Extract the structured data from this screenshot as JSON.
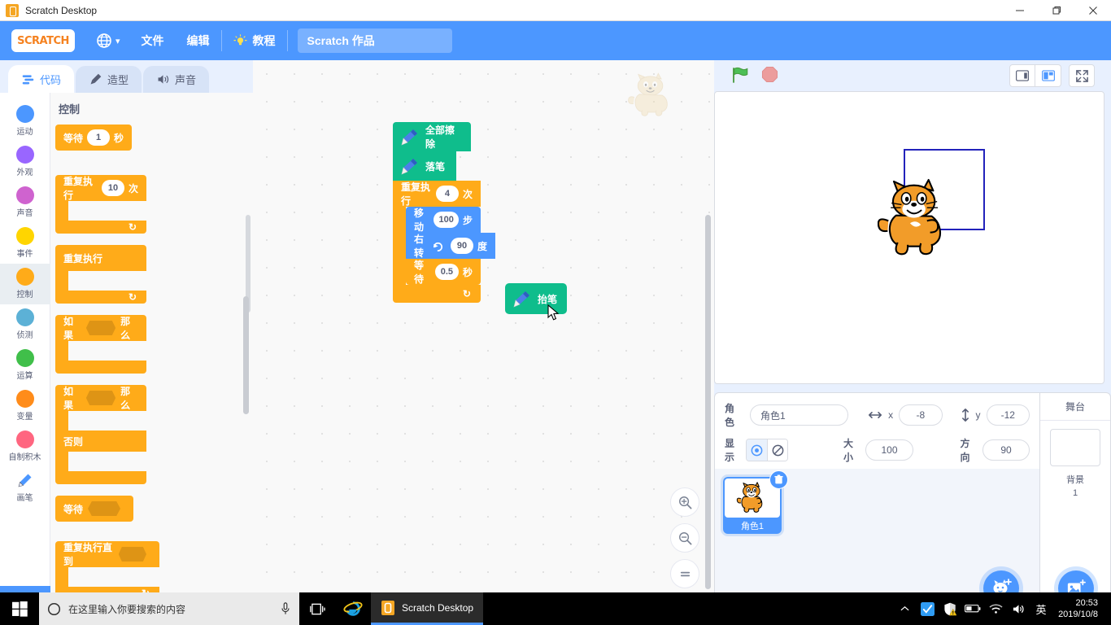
{
  "window": {
    "title": "Scratch Desktop",
    "app_icon": "scratch-app-icon",
    "minimize": "—",
    "maximize": "❐",
    "close": "✕"
  },
  "menubar": {
    "logo": "SCRATCH",
    "globe_icon": "globe-icon",
    "chevron": "▾",
    "items": [
      {
        "label": "文件"
      },
      {
        "label": "编辑"
      }
    ],
    "tutorials": {
      "icon": "lightbulb-icon",
      "label": "教程"
    },
    "project_name": "Scratch 作品"
  },
  "tabs": [
    {
      "label": "代码",
      "icon": "code-icon",
      "active": true
    },
    {
      "label": "造型",
      "icon": "brush-icon",
      "active": false
    },
    {
      "label": "声音",
      "icon": "speaker-icon",
      "active": false
    }
  ],
  "categories": [
    {
      "label": "运动",
      "color": "#4c97ff"
    },
    {
      "label": "外观",
      "color": "#9966ff"
    },
    {
      "label": "声音",
      "color": "#cf63cf"
    },
    {
      "label": "事件",
      "color": "#ffd500"
    },
    {
      "label": "控制",
      "color": "#ffab19",
      "selected": true
    },
    {
      "label": "侦测",
      "color": "#5cb1d6"
    },
    {
      "label": "运算",
      "color": "#40bf4a"
    },
    {
      "label": "变量",
      "color": "#ff8c1a"
    },
    {
      "label": "自制积木",
      "color": "#ff6680"
    },
    {
      "label": "画笔",
      "color": "#0fbd8c",
      "icon": "pen-icon"
    }
  ],
  "add_extension": {
    "label": "add-extension-icon"
  },
  "palette": {
    "title": "控制",
    "blocks": [
      {
        "name": "wait-seconds",
        "prefix": "等待",
        "value": "1",
        "suffix": "秒",
        "type": "stack"
      },
      {
        "name": "repeat-times",
        "prefix": "重复执行",
        "value": "10",
        "suffix": "次",
        "type": "c",
        "loop_arrow": "↻"
      },
      {
        "name": "forever",
        "prefix": "重复执行",
        "type": "c",
        "loop_arrow": "↻"
      },
      {
        "name": "if-then",
        "prefix": "如果",
        "suffix": "那么",
        "type": "c-hex"
      },
      {
        "name": "if-then-else",
        "prefix": "如果",
        "suffix": "那么",
        "else_label": "否则",
        "type": "c-else-hex"
      },
      {
        "name": "wait-until",
        "prefix": "等待",
        "type": "stack-hex"
      },
      {
        "name": "repeat-until",
        "prefix": "重复执行直到",
        "type": "c-hex",
        "loop_arrow": "↻"
      }
    ]
  },
  "script": {
    "blocks": [
      {
        "name": "pen-erase-all",
        "icon": "pen-icon",
        "label": "全部擦除",
        "color": "#0fbd8c"
      },
      {
        "name": "pen-down",
        "icon": "pen-icon",
        "label": "落笔",
        "color": "#0fbd8c"
      },
      {
        "name": "repeat-times",
        "prefix": "重复执行",
        "value": "4",
        "suffix": "次",
        "color": "#ffab19",
        "loop_arrow": "↻"
      },
      {
        "name": "move-steps",
        "prefix": "移动",
        "value": "100",
        "suffix": "步",
        "color": "#4c97ff"
      },
      {
        "name": "turn-right-degrees",
        "prefix": "右转",
        "icon": "turn-right-icon",
        "value": "90",
        "suffix": "度",
        "color": "#4c97ff"
      },
      {
        "name": "wait-seconds",
        "prefix": "等待",
        "value": "0.5",
        "suffix": "秒",
        "color": "#ffab19"
      }
    ],
    "loose_block": {
      "name": "pen-up",
      "icon": "pen-icon",
      "label": "抬笔",
      "color": "#0fbd8c"
    }
  },
  "canvas": {
    "watermark": "scratch-cat-watermark",
    "zoom_in": "zoom-in-icon",
    "zoom_out": "zoom-out-icon",
    "zoom_reset": "zoom-reset-icon"
  },
  "stage_header": {
    "green_flag": "green-flag-icon",
    "stop": "stop-icon",
    "small_stage": "small-stage-icon",
    "large_stage": "large-stage-icon",
    "fullscreen": "fullscreen-icon"
  },
  "stage": {
    "drawing": {
      "shape": "square",
      "color": "#2222bb"
    },
    "sprite": "scratch-cat"
  },
  "sprite_info": {
    "sprite_label": "角色",
    "sprite_name": "角色1",
    "x_label": "x",
    "x_value": "-8",
    "y_label": "y",
    "y_value": "-12",
    "show_label": "显示",
    "show_icon": "eye-visible-icon",
    "hide_icon": "eye-hidden-icon",
    "size_label": "大小",
    "size_value": "100",
    "direction_label": "方向",
    "direction_value": "90"
  },
  "sprite_list": {
    "sprites": [
      {
        "name": "角色1",
        "selected": true,
        "delete_icon": "trash-icon"
      }
    ],
    "add_sprite": "add-sprite-icon"
  },
  "stage_panel": {
    "title": "舞台",
    "backdrop_label": "背景",
    "backdrop_count": "1",
    "add_backdrop": "add-backdrop-icon"
  },
  "taskbar": {
    "start": "windows-start-icon",
    "search_icon": "cortana-circle-icon",
    "search_placeholder": "在这里输入你要搜索的内容",
    "mic_icon": "microphone-icon",
    "taskview_icon": "task-view-icon",
    "apps": [
      {
        "name": "internet-explorer",
        "label": ""
      },
      {
        "name": "scratch-desktop",
        "label": "Scratch Desktop",
        "active": true
      }
    ],
    "tray": [
      {
        "name": "show-hidden-icons",
        "glyph": "︿"
      },
      {
        "name": "sogou-input-icon",
        "glyph": "✔"
      },
      {
        "name": "security-warning-icon",
        "glyph": "🛡"
      },
      {
        "name": "battery-icon",
        "glyph": "▭"
      },
      {
        "name": "wifi-icon",
        "glyph": "📶"
      },
      {
        "name": "volume-icon",
        "glyph": "🔊"
      },
      {
        "name": "language-icon",
        "glyph": "英"
      }
    ],
    "time": "20:53",
    "date": "2019/10/8"
  }
}
